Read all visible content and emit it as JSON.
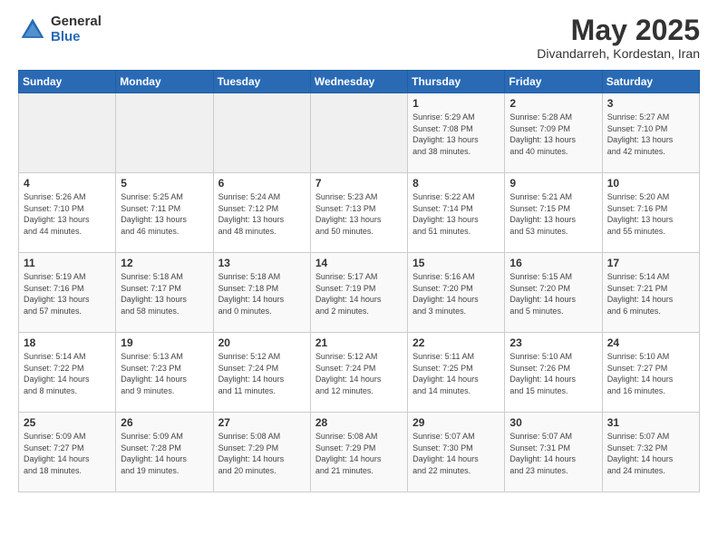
{
  "logo": {
    "general": "General",
    "blue": "Blue"
  },
  "title": {
    "month_year": "May 2025",
    "location": "Divandarreh, Kordestan, Iran"
  },
  "days_header": [
    "Sunday",
    "Monday",
    "Tuesday",
    "Wednesday",
    "Thursday",
    "Friday",
    "Saturday"
  ],
  "weeks": [
    [
      {
        "day": "",
        "content": ""
      },
      {
        "day": "",
        "content": ""
      },
      {
        "day": "",
        "content": ""
      },
      {
        "day": "",
        "content": ""
      },
      {
        "day": "1",
        "content": "Sunrise: 5:29 AM\nSunset: 7:08 PM\nDaylight: 13 hours\nand 38 minutes."
      },
      {
        "day": "2",
        "content": "Sunrise: 5:28 AM\nSunset: 7:09 PM\nDaylight: 13 hours\nand 40 minutes."
      },
      {
        "day": "3",
        "content": "Sunrise: 5:27 AM\nSunset: 7:10 PM\nDaylight: 13 hours\nand 42 minutes."
      }
    ],
    [
      {
        "day": "4",
        "content": "Sunrise: 5:26 AM\nSunset: 7:10 PM\nDaylight: 13 hours\nand 44 minutes."
      },
      {
        "day": "5",
        "content": "Sunrise: 5:25 AM\nSunset: 7:11 PM\nDaylight: 13 hours\nand 46 minutes."
      },
      {
        "day": "6",
        "content": "Sunrise: 5:24 AM\nSunset: 7:12 PM\nDaylight: 13 hours\nand 48 minutes."
      },
      {
        "day": "7",
        "content": "Sunrise: 5:23 AM\nSunset: 7:13 PM\nDaylight: 13 hours\nand 50 minutes."
      },
      {
        "day": "8",
        "content": "Sunrise: 5:22 AM\nSunset: 7:14 PM\nDaylight: 13 hours\nand 51 minutes."
      },
      {
        "day": "9",
        "content": "Sunrise: 5:21 AM\nSunset: 7:15 PM\nDaylight: 13 hours\nand 53 minutes."
      },
      {
        "day": "10",
        "content": "Sunrise: 5:20 AM\nSunset: 7:16 PM\nDaylight: 13 hours\nand 55 minutes."
      }
    ],
    [
      {
        "day": "11",
        "content": "Sunrise: 5:19 AM\nSunset: 7:16 PM\nDaylight: 13 hours\nand 57 minutes."
      },
      {
        "day": "12",
        "content": "Sunrise: 5:18 AM\nSunset: 7:17 PM\nDaylight: 13 hours\nand 58 minutes."
      },
      {
        "day": "13",
        "content": "Sunrise: 5:18 AM\nSunset: 7:18 PM\nDaylight: 14 hours\nand 0 minutes."
      },
      {
        "day": "14",
        "content": "Sunrise: 5:17 AM\nSunset: 7:19 PM\nDaylight: 14 hours\nand 2 minutes."
      },
      {
        "day": "15",
        "content": "Sunrise: 5:16 AM\nSunset: 7:20 PM\nDaylight: 14 hours\nand 3 minutes."
      },
      {
        "day": "16",
        "content": "Sunrise: 5:15 AM\nSunset: 7:20 PM\nDaylight: 14 hours\nand 5 minutes."
      },
      {
        "day": "17",
        "content": "Sunrise: 5:14 AM\nSunset: 7:21 PM\nDaylight: 14 hours\nand 6 minutes."
      }
    ],
    [
      {
        "day": "18",
        "content": "Sunrise: 5:14 AM\nSunset: 7:22 PM\nDaylight: 14 hours\nand 8 minutes."
      },
      {
        "day": "19",
        "content": "Sunrise: 5:13 AM\nSunset: 7:23 PM\nDaylight: 14 hours\nand 9 minutes."
      },
      {
        "day": "20",
        "content": "Sunrise: 5:12 AM\nSunset: 7:24 PM\nDaylight: 14 hours\nand 11 minutes."
      },
      {
        "day": "21",
        "content": "Sunrise: 5:12 AM\nSunset: 7:24 PM\nDaylight: 14 hours\nand 12 minutes."
      },
      {
        "day": "22",
        "content": "Sunrise: 5:11 AM\nSunset: 7:25 PM\nDaylight: 14 hours\nand 14 minutes."
      },
      {
        "day": "23",
        "content": "Sunrise: 5:10 AM\nSunset: 7:26 PM\nDaylight: 14 hours\nand 15 minutes."
      },
      {
        "day": "24",
        "content": "Sunrise: 5:10 AM\nSunset: 7:27 PM\nDaylight: 14 hours\nand 16 minutes."
      }
    ],
    [
      {
        "day": "25",
        "content": "Sunrise: 5:09 AM\nSunset: 7:27 PM\nDaylight: 14 hours\nand 18 minutes."
      },
      {
        "day": "26",
        "content": "Sunrise: 5:09 AM\nSunset: 7:28 PM\nDaylight: 14 hours\nand 19 minutes."
      },
      {
        "day": "27",
        "content": "Sunrise: 5:08 AM\nSunset: 7:29 PM\nDaylight: 14 hours\nand 20 minutes."
      },
      {
        "day": "28",
        "content": "Sunrise: 5:08 AM\nSunset: 7:29 PM\nDaylight: 14 hours\nand 21 minutes."
      },
      {
        "day": "29",
        "content": "Sunrise: 5:07 AM\nSunset: 7:30 PM\nDaylight: 14 hours\nand 22 minutes."
      },
      {
        "day": "30",
        "content": "Sunrise: 5:07 AM\nSunset: 7:31 PM\nDaylight: 14 hours\nand 23 minutes."
      },
      {
        "day": "31",
        "content": "Sunrise: 5:07 AM\nSunset: 7:32 PM\nDaylight: 14 hours\nand 24 minutes."
      }
    ]
  ]
}
